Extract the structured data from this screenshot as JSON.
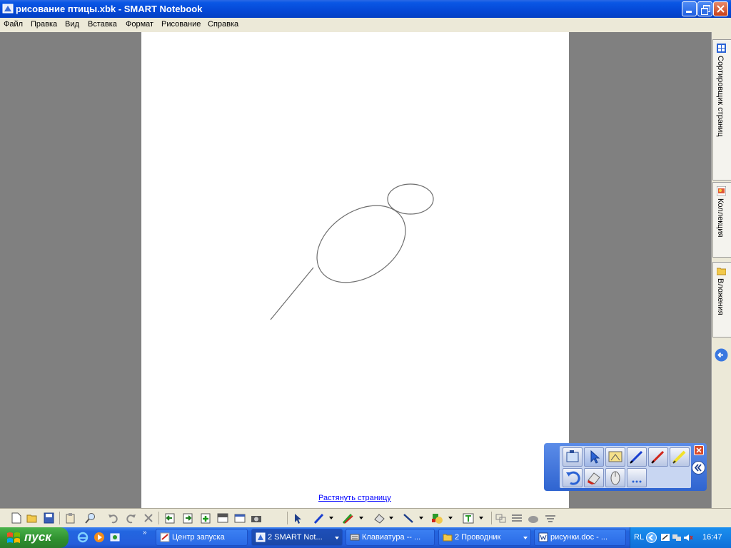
{
  "window": {
    "title": "рисование птицы.xbk - SMART Notebook"
  },
  "menu": [
    "Файл",
    "Правка",
    "Вид",
    "Вставка",
    "Формат",
    "Рисование",
    "Справка"
  ],
  "page": {
    "stretch_link": "Растянуть страницу"
  },
  "side_tabs": [
    {
      "label": "Сортировщик страниц",
      "icon": "page-sorter-icon"
    },
    {
      "label": "Коллекция",
      "icon": "gallery-icon"
    },
    {
      "label": "Вложения",
      "icon": "folder-icon"
    }
  ],
  "taskbar": {
    "start_label": "пуск",
    "tasks": [
      {
        "label": "Центр запуска",
        "icon": "launch-center-icon"
      },
      {
        "label": "2 SMART Not...",
        "icon": "smart-notebook-icon",
        "active": true
      },
      {
        "label": "Клавиатура -- ...",
        "icon": "keyboard-icon"
      },
      {
        "label": "2 Проводник",
        "icon": "folder-icon"
      },
      {
        "label": "рисунки.doc - ...",
        "icon": "word-icon"
      }
    ],
    "lang": "RL",
    "clock": "16:47"
  },
  "colors": {
    "title_bar": "#0548d6",
    "taskbar": "#245edc",
    "start": "#2e8f2e",
    "workspace": "#808080"
  }
}
